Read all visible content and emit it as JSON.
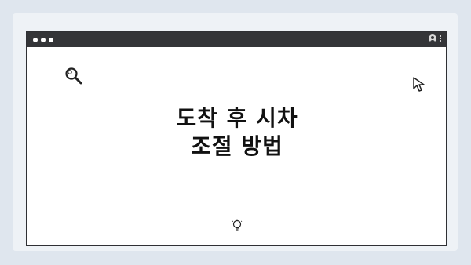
{
  "title": {
    "line1": "도착 후 시차",
    "line2": "조절 방법"
  },
  "icons": {
    "search": "search-icon",
    "cursor": "cursor-icon",
    "bulb": "lightbulb-icon",
    "avatar": "avatar-icon",
    "menu": "kebab-menu-icon"
  },
  "colors": {
    "background": "#dfe6ee",
    "card": "#eef2f6",
    "titlebar": "#343538",
    "window": "#ffffff",
    "text": "#111111"
  }
}
